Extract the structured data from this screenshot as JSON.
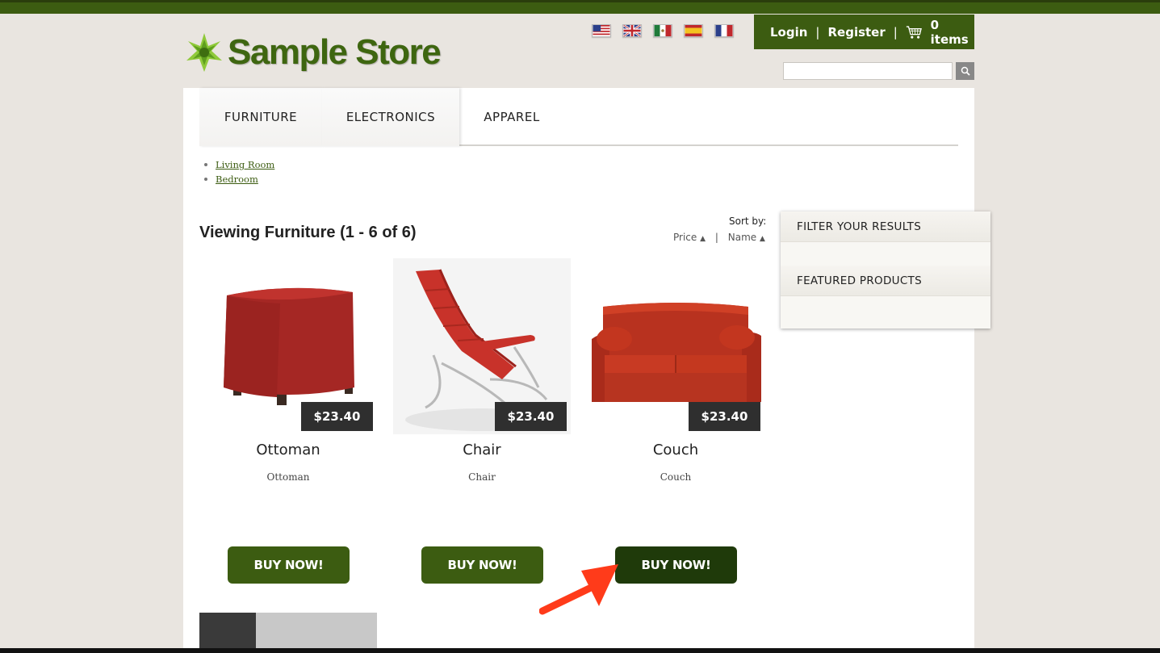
{
  "store": {
    "name": "Sample Store"
  },
  "flags": [
    "us-flag-icon",
    "uk-flag-icon",
    "mexico-flag-icon",
    "spain-flag-icon",
    "france-flag-icon"
  ],
  "account": {
    "login": "Login",
    "separator": "|",
    "register": "Register",
    "cart": "0 items"
  },
  "search": {
    "placeholder": ""
  },
  "nav": {
    "tabs": [
      "FURNITURE",
      "ELECTRONICS",
      "APPAREL"
    ]
  },
  "subcategories": [
    "Living Room",
    "Bedroom"
  ],
  "listing": {
    "heading": "Viewing Furniture (1 - 6 of 6)",
    "sort_label": "Sort by:",
    "sort_price": "Price",
    "sort_name": "Name",
    "sort_arrow": "▲",
    "sort_sep": "|"
  },
  "products": [
    {
      "price": "$23.40",
      "name": "Ottoman",
      "desc": "Ottoman",
      "buy": "BUY NOW!"
    },
    {
      "price": "$23.40",
      "name": "Chair",
      "desc": "Chair",
      "buy": "BUY NOW!"
    },
    {
      "price": "$23.40",
      "name": "Couch",
      "desc": "Couch",
      "buy": "BUY NOW!"
    }
  ],
  "sidebar": {
    "filter": "FILTER YOUR RESULTS",
    "featured": "FEATURED PRODUCTS"
  },
  "colors": {
    "brand_green": "#3c5c11",
    "buy_hover": "#1f3a0a",
    "price_bg": "#2f2f2f",
    "arrow": "#ff3b1a"
  }
}
